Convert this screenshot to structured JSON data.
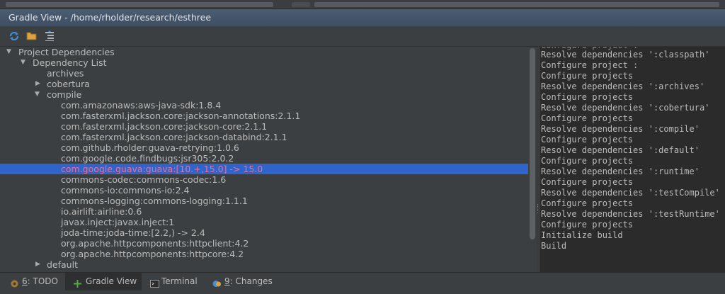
{
  "window": {
    "title": "Gradle View - /home/rholder/research/esthree"
  },
  "toolbar": {
    "refresh_icon": "refresh-icon",
    "open_folder_icon": "folder-icon",
    "collapse_icon": "collapse-tree-icon"
  },
  "tree": {
    "root": "Project Dependencies",
    "dependency_list": "Dependency List",
    "archives": "archives",
    "cobertura": "cobertura",
    "compile": "compile",
    "compile_items": [
      "com.amazonaws:aws-java-sdk:1.8.4",
      "com.fasterxml.jackson.core:jackson-annotations:2.1.1",
      "com.fasterxml.jackson.core:jackson-core:2.1.1",
      "com.fasterxml.jackson.core:jackson-databind:2.1.1",
      "com.github.rholder:guava-retrying:1.0.6",
      "com.google.code.findbugs:jsr305:2.0.2",
      "com.google.guava:guava:[10.+,15.0] -> 15.0",
      "commons-codec:commons-codec:1.6",
      "commons-io:commons-io:2.4",
      "commons-logging:commons-logging:1.1.1",
      "io.airlift:airline:0.6",
      "javax.inject:javax.inject:1",
      "joda-time:joda-time:[2.2,) -> 2.4",
      "org.apache.httpcomponents:httpclient:4.2",
      "org.apache.httpcomponents:httpcore:4.2"
    ],
    "default": "default",
    "selected_index": 6
  },
  "console": {
    "lines": [
      "Resolve dependencies ':classpath'",
      "Configure project :",
      "Configure projects",
      "Resolve dependencies ':archives'",
      "Configure projects",
      "Resolve dependencies ':cobertura'",
      "Configure projects",
      "Resolve dependencies ':compile'",
      "Configure projects",
      "Resolve dependencies ':default'",
      "Configure projects",
      "Resolve dependencies ':runtime'",
      "Configure projects",
      "Resolve dependencies ':testCompile'",
      "Configure projects",
      "Resolve dependencies ':testRuntime'",
      "Configure projects",
      "Initialize build",
      "Build"
    ]
  },
  "bottom_tabs": {
    "todo_num": "6",
    "todo_label": ": TODO",
    "gradle_label": "Gradle View",
    "terminal_label": "Terminal",
    "changes_num": "9",
    "changes_label": ": Changes"
  }
}
